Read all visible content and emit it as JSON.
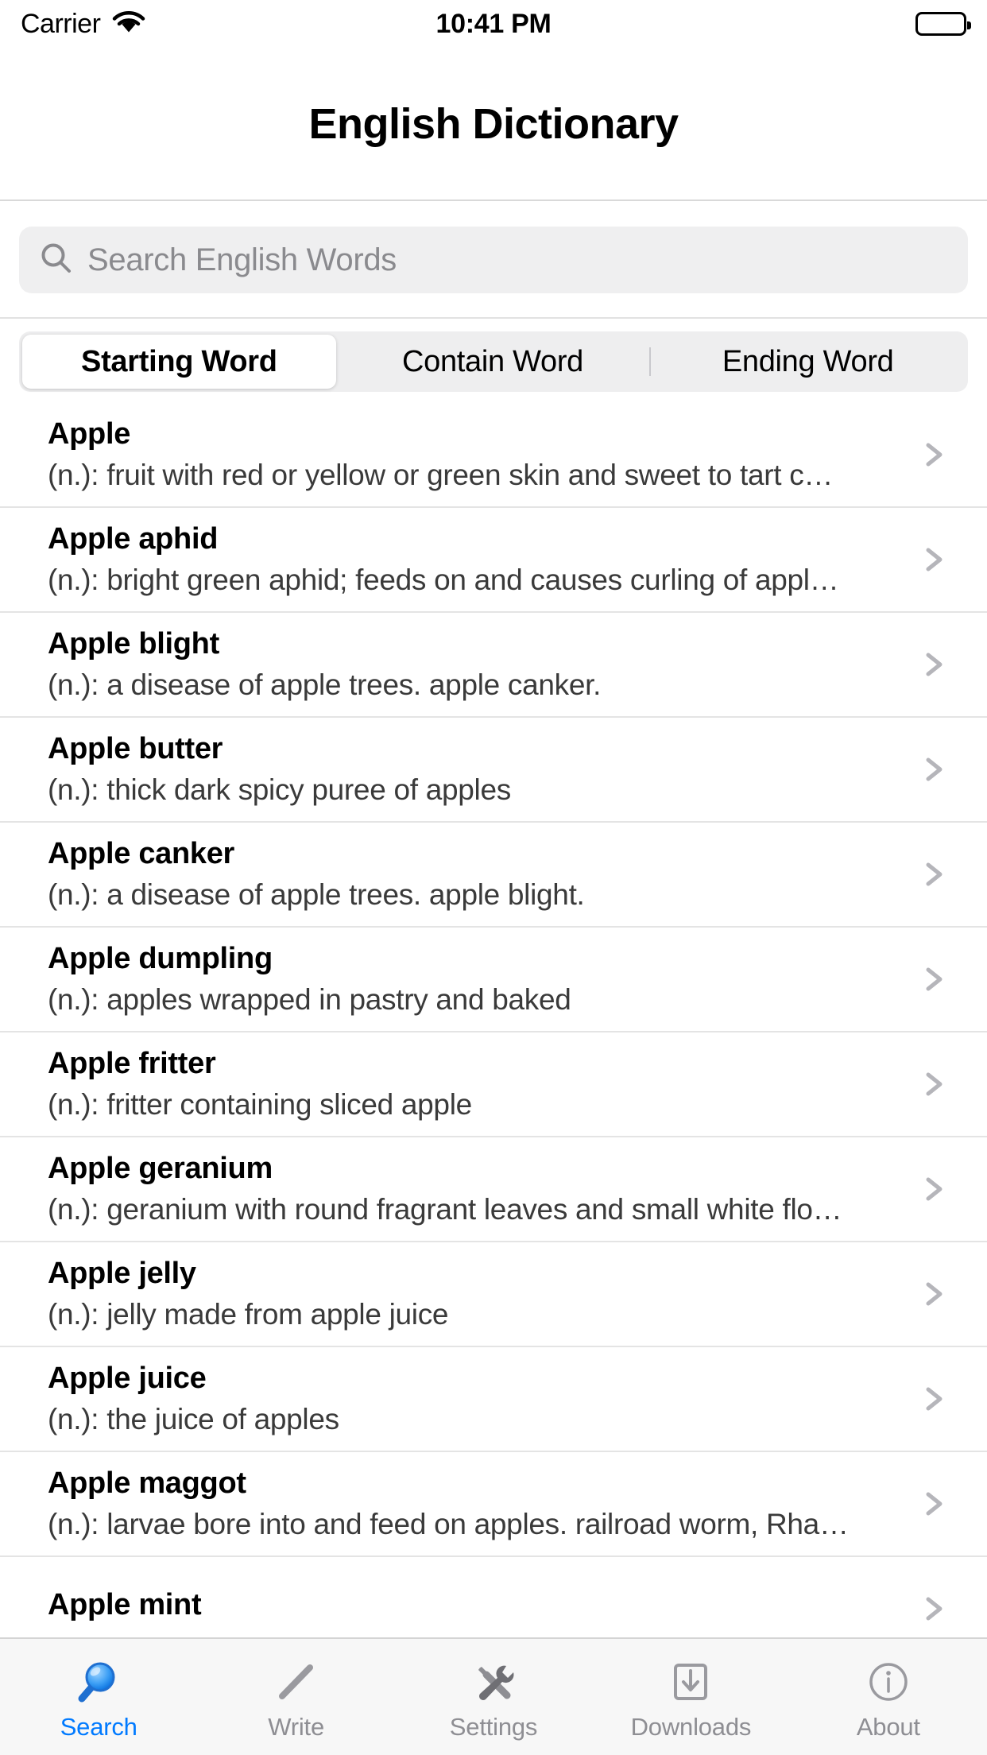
{
  "status_bar": {
    "carrier": "Carrier",
    "wifi_icon": "wifi-icon",
    "time": "10:41 PM",
    "battery_icon": "battery-full-icon"
  },
  "nav": {
    "title": "English Dictionary"
  },
  "search": {
    "icon": "search-icon",
    "placeholder": "Search English Words",
    "value": ""
  },
  "segmented": {
    "items": [
      {
        "label": "Starting Word",
        "active": true
      },
      {
        "label": "Contain Word",
        "active": false
      },
      {
        "label": "Ending Word",
        "active": false
      }
    ]
  },
  "list": {
    "items": [
      {
        "word": "Apple",
        "definition": "(n.): fruit with red or yellow or green skin and sweet to tart c…"
      },
      {
        "word": "Apple aphid",
        "definition": "(n.): bright green aphid; feeds on and causes curling of appl…"
      },
      {
        "word": "Apple blight",
        "definition": "(n.): a disease of apple trees.  apple canker."
      },
      {
        "word": "Apple butter",
        "definition": "(n.): thick dark spicy puree of apples"
      },
      {
        "word": "Apple canker",
        "definition": "(n.): a disease of apple trees.  apple blight."
      },
      {
        "word": "Apple dumpling",
        "definition": "(n.): apples wrapped in pastry and baked"
      },
      {
        "word": "Apple fritter",
        "definition": "(n.): fritter containing sliced apple"
      },
      {
        "word": "Apple geranium",
        "definition": "(n.): geranium with round fragrant leaves and small white flo…"
      },
      {
        "word": "Apple jelly",
        "definition": "(n.): jelly made from apple juice"
      },
      {
        "word": "Apple juice",
        "definition": "(n.): the juice of apples"
      },
      {
        "word": "Apple maggot",
        "definition": "(n.): larvae bore into and feed on apples.  railroad worm, Rha…"
      },
      {
        "word": "Apple mint",
        "definition": ""
      }
    ]
  },
  "tab_bar": {
    "items": [
      {
        "label": "Search",
        "icon": "magnifier-icon",
        "active": true
      },
      {
        "label": "Write",
        "icon": "pencil-icon",
        "active": false
      },
      {
        "label": "Settings",
        "icon": "tools-icon",
        "active": false
      },
      {
        "label": "Downloads",
        "icon": "download-tray-icon",
        "active": false
      },
      {
        "label": "About",
        "icon": "info-circle-icon",
        "active": false
      }
    ]
  },
  "colors": {
    "accent": "#007aff",
    "inactive": "#8e8e93",
    "separator": "#e4e4e4",
    "field_bg": "#efeff0"
  }
}
